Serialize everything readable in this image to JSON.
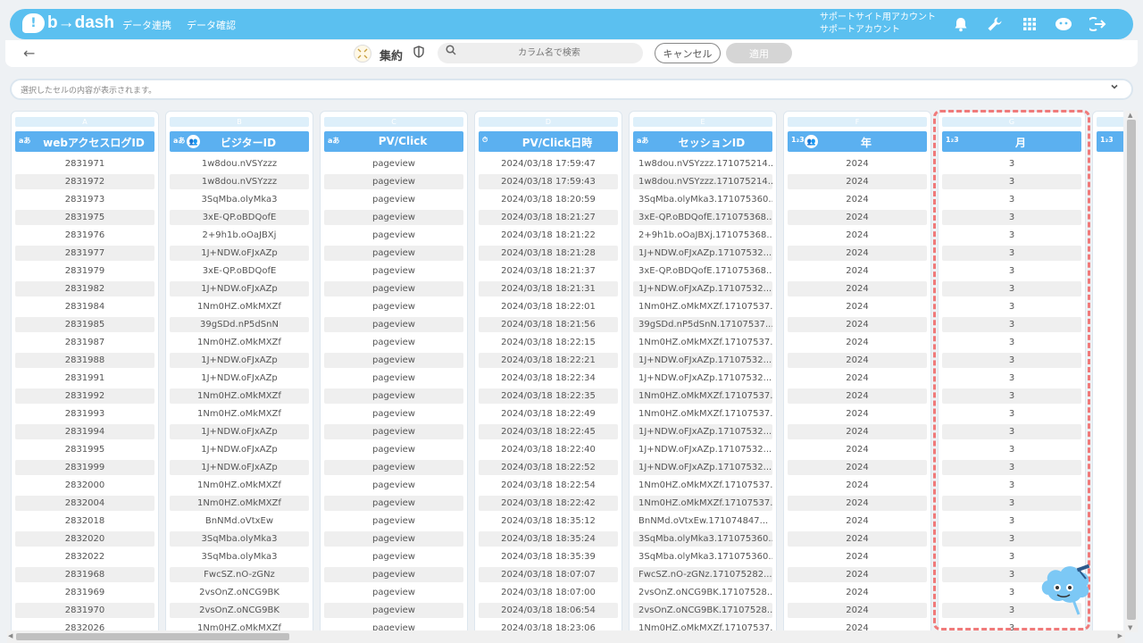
{
  "header": {
    "logo_mark": "!",
    "logo_text": "b→dash",
    "nav": [
      "データ連携",
      "データ確認"
    ],
    "account_line1": "サポートサイト用アカウント",
    "account_line2": "サポートアカウント",
    "icons": [
      "bell-icon",
      "wrench-icon",
      "apps-icon",
      "support-bot-icon",
      "logout-icon"
    ]
  },
  "toolbar": {
    "back_glyph": "←",
    "aggregate_label": "集約",
    "search_placeholder": "カラム名で検索",
    "cancel_label": "キャンセル",
    "apply_label": "適用"
  },
  "cellbar": {
    "placeholder": "選択したセルの内容が表示されます。"
  },
  "columns": [
    {
      "letter": "A",
      "type": "aあ",
      "title": "webアクセスログID",
      "group": false
    },
    {
      "letter": "B",
      "type": "aあ",
      "title": "ビジターID",
      "group": true
    },
    {
      "letter": "C",
      "type": "aあ",
      "title": "PV/Click",
      "group": false
    },
    {
      "letter": "D",
      "type": "⏱",
      "title": "PV/Click日時",
      "group": false
    },
    {
      "letter": "E",
      "type": "aあ",
      "title": "セッションID",
      "group": false
    },
    {
      "letter": "F",
      "type": "1₂3",
      "title": "年",
      "group": true
    },
    {
      "letter": "G",
      "type": "1₂3",
      "title": "月",
      "group": false
    },
    {
      "letter": "H",
      "type": "1₂3",
      "title": "",
      "group": false
    }
  ],
  "rows": [
    [
      "2831971",
      "1w8dou.nVSYzzz",
      "pageview",
      "2024/03/18 17:59:47",
      "1w8dou.nVSYzzz.171075214...",
      "2024",
      "3"
    ],
    [
      "2831972",
      "1w8dou.nVSYzzz",
      "pageview",
      "2024/03/18 17:59:43",
      "1w8dou.nVSYzzz.171075214...",
      "2024",
      "3"
    ],
    [
      "2831973",
      "3SqMba.olyMka3",
      "pageview",
      "2024/03/18 18:20:59",
      "3SqMba.olyMka3.171075360...",
      "2024",
      "3"
    ],
    [
      "2831975",
      "3xE-QP.oBDQofE",
      "pageview",
      "2024/03/18 18:21:27",
      "3xE-QP.oBDQofE.171075368...",
      "2024",
      "3"
    ],
    [
      "2831976",
      "2+9h1b.oOaJBXj",
      "pageview",
      "2024/03/18 18:21:22",
      "2+9h1b.oOaJBXj.171075368...",
      "2024",
      "3"
    ],
    [
      "2831977",
      "1J+NDW.oFJxAZp",
      "pageview",
      "2024/03/18 18:21:28",
      "1J+NDW.oFJxAZp.17107532...",
      "2024",
      "3"
    ],
    [
      "2831979",
      "3xE-QP.oBDQofE",
      "pageview",
      "2024/03/18 18:21:37",
      "3xE-QP.oBDQofE.171075368...",
      "2024",
      "3"
    ],
    [
      "2831982",
      "1J+NDW.oFJxAZp",
      "pageview",
      "2024/03/18 18:21:31",
      "1J+NDW.oFJxAZp.17107532...",
      "2024",
      "3"
    ],
    [
      "2831984",
      "1Nm0HZ.oMkMXZf",
      "pageview",
      "2024/03/18 18:22:01",
      "1Nm0HZ.oMkMXZf.17107537...",
      "2024",
      "3"
    ],
    [
      "2831985",
      "39gSDd.nP5dSnN",
      "pageview",
      "2024/03/18 18:21:56",
      "39gSDd.nP5dSnN.17107537...",
      "2024",
      "3"
    ],
    [
      "2831987",
      "1Nm0HZ.oMkMXZf",
      "pageview",
      "2024/03/18 18:22:15",
      "1Nm0HZ.oMkMXZf.17107537...",
      "2024",
      "3"
    ],
    [
      "2831988",
      "1J+NDW.oFJxAZp",
      "pageview",
      "2024/03/18 18:22:21",
      "1J+NDW.oFJxAZp.17107532...",
      "2024",
      "3"
    ],
    [
      "2831991",
      "1J+NDW.oFJxAZp",
      "pageview",
      "2024/03/18 18:22:34",
      "1J+NDW.oFJxAZp.17107532...",
      "2024",
      "3"
    ],
    [
      "2831992",
      "1Nm0HZ.oMkMXZf",
      "pageview",
      "2024/03/18 18:22:35",
      "1Nm0HZ.oMkMXZf.17107537...",
      "2024",
      "3"
    ],
    [
      "2831993",
      "1Nm0HZ.oMkMXZf",
      "pageview",
      "2024/03/18 18:22:49",
      "1Nm0HZ.oMkMXZf.17107537...",
      "2024",
      "3"
    ],
    [
      "2831994",
      "1J+NDW.oFJxAZp",
      "pageview",
      "2024/03/18 18:22:45",
      "1J+NDW.oFJxAZp.17107532...",
      "2024",
      "3"
    ],
    [
      "2831995",
      "1J+NDW.oFJxAZp",
      "pageview",
      "2024/03/18 18:22:40",
      "1J+NDW.oFJxAZp.17107532...",
      "2024",
      "3"
    ],
    [
      "2831999",
      "1J+NDW.oFJxAZp",
      "pageview",
      "2024/03/18 18:22:52",
      "1J+NDW.oFJxAZp.17107532...",
      "2024",
      "3"
    ],
    [
      "2832000",
      "1Nm0HZ.oMkMXZf",
      "pageview",
      "2024/03/18 18:22:54",
      "1Nm0HZ.oMkMXZf.17107537...",
      "2024",
      "3"
    ],
    [
      "2832004",
      "1Nm0HZ.oMkMXZf",
      "pageview",
      "2024/03/18 18:22:42",
      "1Nm0HZ.oMkMXZf.17107537...",
      "2024",
      "3"
    ],
    [
      "2832018",
      "BnNMd.oVtxEw",
      "pageview",
      "2024/03/18 18:35:12",
      "BnNMd.oVtxEw.171074847...",
      "2024",
      "3"
    ],
    [
      "2832020",
      "3SqMba.olyMka3",
      "pageview",
      "2024/03/18 18:35:24",
      "3SqMba.olyMka3.171075360...",
      "2024",
      "3"
    ],
    [
      "2832022",
      "3SqMba.olyMka3",
      "pageview",
      "2024/03/18 18:35:39",
      "3SqMba.olyMka3.171075360...",
      "2024",
      "3"
    ],
    [
      "2831968",
      "FwcSZ.nO-zGNz",
      "pageview",
      "2024/03/18 18:07:07",
      "FwcSZ.nO-zGNz.171075282...",
      "2024",
      "3"
    ],
    [
      "2831969",
      "2vsOnZ.oNCG9BK",
      "pageview",
      "2024/03/18 18:07:00",
      "2vsOnZ.oNCG9BK.17107528...",
      "2024",
      "3"
    ],
    [
      "2831970",
      "2vsOnZ.oNCG9BK",
      "pageview",
      "2024/03/18 18:06:54",
      "2vsOnZ.oNCG9BK.17107528...",
      "2024",
      "3"
    ],
    [
      "2832026",
      "1Nm0HZ.oMkMXZf",
      "pageview",
      "2024/03/18 18:23:06",
      "1Nm0HZ.oMkMXZf.17107537...",
      "2024",
      "3"
    ]
  ],
  "colors": {
    "header_blue": "#5bc0f0",
    "column_header_blue": "#5bb0f0",
    "highlight_dash": "#f07a7a"
  }
}
